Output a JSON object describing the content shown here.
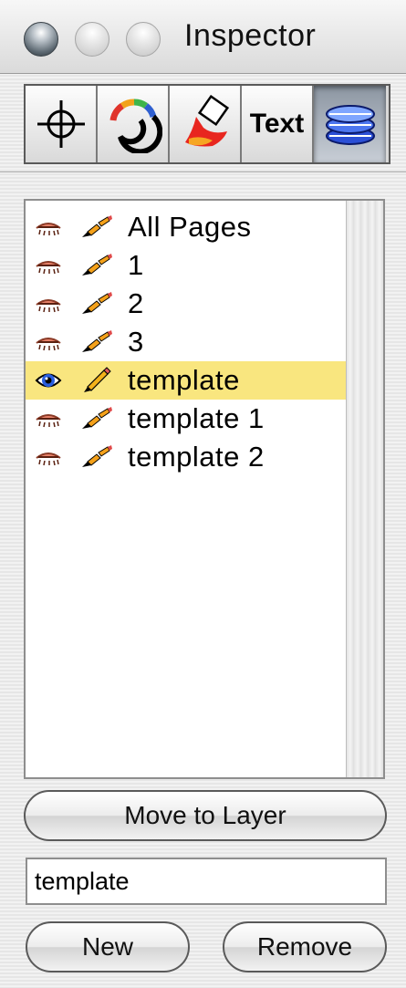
{
  "window": {
    "title": "Inspector"
  },
  "toolbar": {
    "tools": [
      {
        "icon": "crosshair-icon",
        "selected": false
      },
      {
        "icon": "color-wheel-icon",
        "selected": false
      },
      {
        "icon": "paint-bucket-icon",
        "selected": false
      },
      {
        "icon": "text-icon",
        "label": "Text",
        "selected": false
      },
      {
        "icon": "layers-icon",
        "selected": true
      }
    ]
  },
  "layers": {
    "items": [
      {
        "label": "All Pages",
        "visible": false,
        "editable": false,
        "selected": false
      },
      {
        "label": "1",
        "visible": false,
        "editable": false,
        "selected": false
      },
      {
        "label": "2",
        "visible": false,
        "editable": false,
        "selected": false
      },
      {
        "label": "3",
        "visible": false,
        "editable": false,
        "selected": false
      },
      {
        "label": "template",
        "visible": true,
        "editable": true,
        "selected": true
      },
      {
        "label": "template 1",
        "visible": false,
        "editable": false,
        "selected": false
      },
      {
        "label": "template 2",
        "visible": false,
        "editable": false,
        "selected": false
      }
    ]
  },
  "actions": {
    "move_label": "Move to Layer",
    "name_value": "template",
    "new_label": "New",
    "remove_label": "Remove"
  },
  "colors": {
    "selection": "#f9e67f"
  }
}
